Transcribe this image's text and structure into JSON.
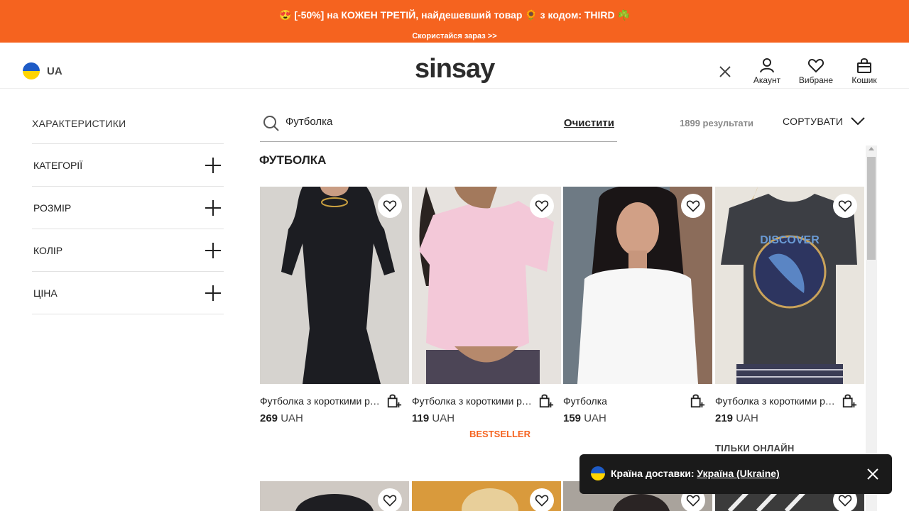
{
  "promo": {
    "line1": "😍 [-50%] на КОЖЕН ТРЕТІЙ, найдешевший товар 🌻 з кодом: THIRD ☘️",
    "line2": "Скористайся зараз >>"
  },
  "header": {
    "country_code": "UA",
    "logo": "sinsay",
    "account_label": "Акаунт",
    "favorites_label": "Вибране",
    "cart_label": "Кошик"
  },
  "sidebar": {
    "title": "ХАРАКТЕРИСТИКИ",
    "items": [
      {
        "label": "КАТЕГОРІЇ"
      },
      {
        "label": "РОЗМІР"
      },
      {
        "label": "КОЛІР"
      },
      {
        "label": "ЦІНА"
      }
    ]
  },
  "search": {
    "value": "Футболка",
    "clear_label": "Очистити",
    "results": "1899 результати",
    "sort_label": "СОРТУВАТИ"
  },
  "heading": "ФУТБОЛКА",
  "products": [
    {
      "name": "Футболка з короткими рукавами",
      "price": "269",
      "currency": "UAH",
      "badge": ""
    },
    {
      "name": "Футболка з короткими рукавами",
      "price": "119",
      "currency": "UAH",
      "badge": "BESTSELLER"
    },
    {
      "name": "Футболка",
      "price": "159",
      "currency": "UAH",
      "badge": ""
    },
    {
      "name": "Футболка з короткими рукавами",
      "price": "219",
      "currency": "UAH",
      "badge": "ТІЛЬКИ ОНЛАЙН"
    }
  ],
  "toast": {
    "label": "Країна доставки:",
    "country": "Україна (Ukraine)"
  },
  "colors": {
    "accent": "#f5631f",
    "toast_bg": "#1a1a1a"
  }
}
